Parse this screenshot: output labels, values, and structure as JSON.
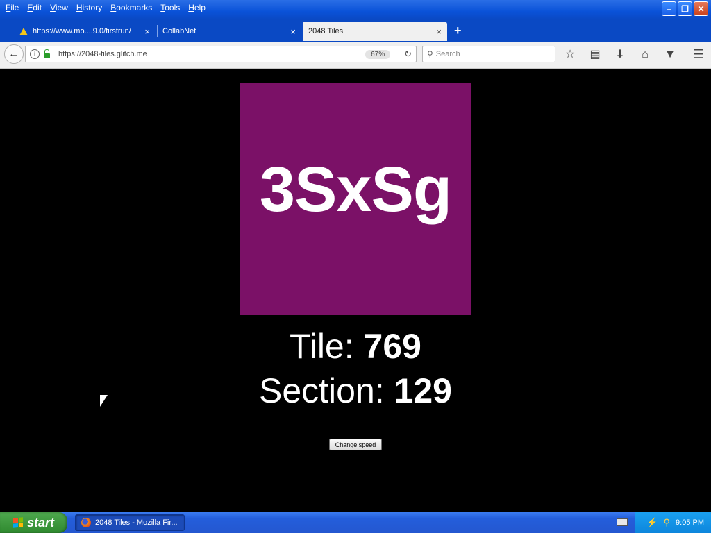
{
  "menubar": {
    "items": [
      "File",
      "Edit",
      "View",
      "History",
      "Bookmarks",
      "Tools",
      "Help"
    ]
  },
  "tabs": [
    {
      "title": "https://www.mo....9.0/firstrun/",
      "close": "×"
    },
    {
      "title": "CollabNet",
      "close": "×"
    },
    {
      "title": "2048 Tiles",
      "close": "×"
    }
  ],
  "newtab_label": "+",
  "navbar": {
    "url": "https://2048-tiles.glitch.me",
    "zoom": "67%",
    "search_placeholder": "Search"
  },
  "page": {
    "tile_text": "3SxSg",
    "tile_color": "#7b1167",
    "tile_label": "Tile: ",
    "tile_value": "769",
    "section_label": "Section: ",
    "section_value": "129",
    "speed_button": "Change speed"
  },
  "taskbar": {
    "start_label": "start",
    "task_title": "2048 Tiles - Mozilla Fir...",
    "clock": "9:05 PM"
  }
}
